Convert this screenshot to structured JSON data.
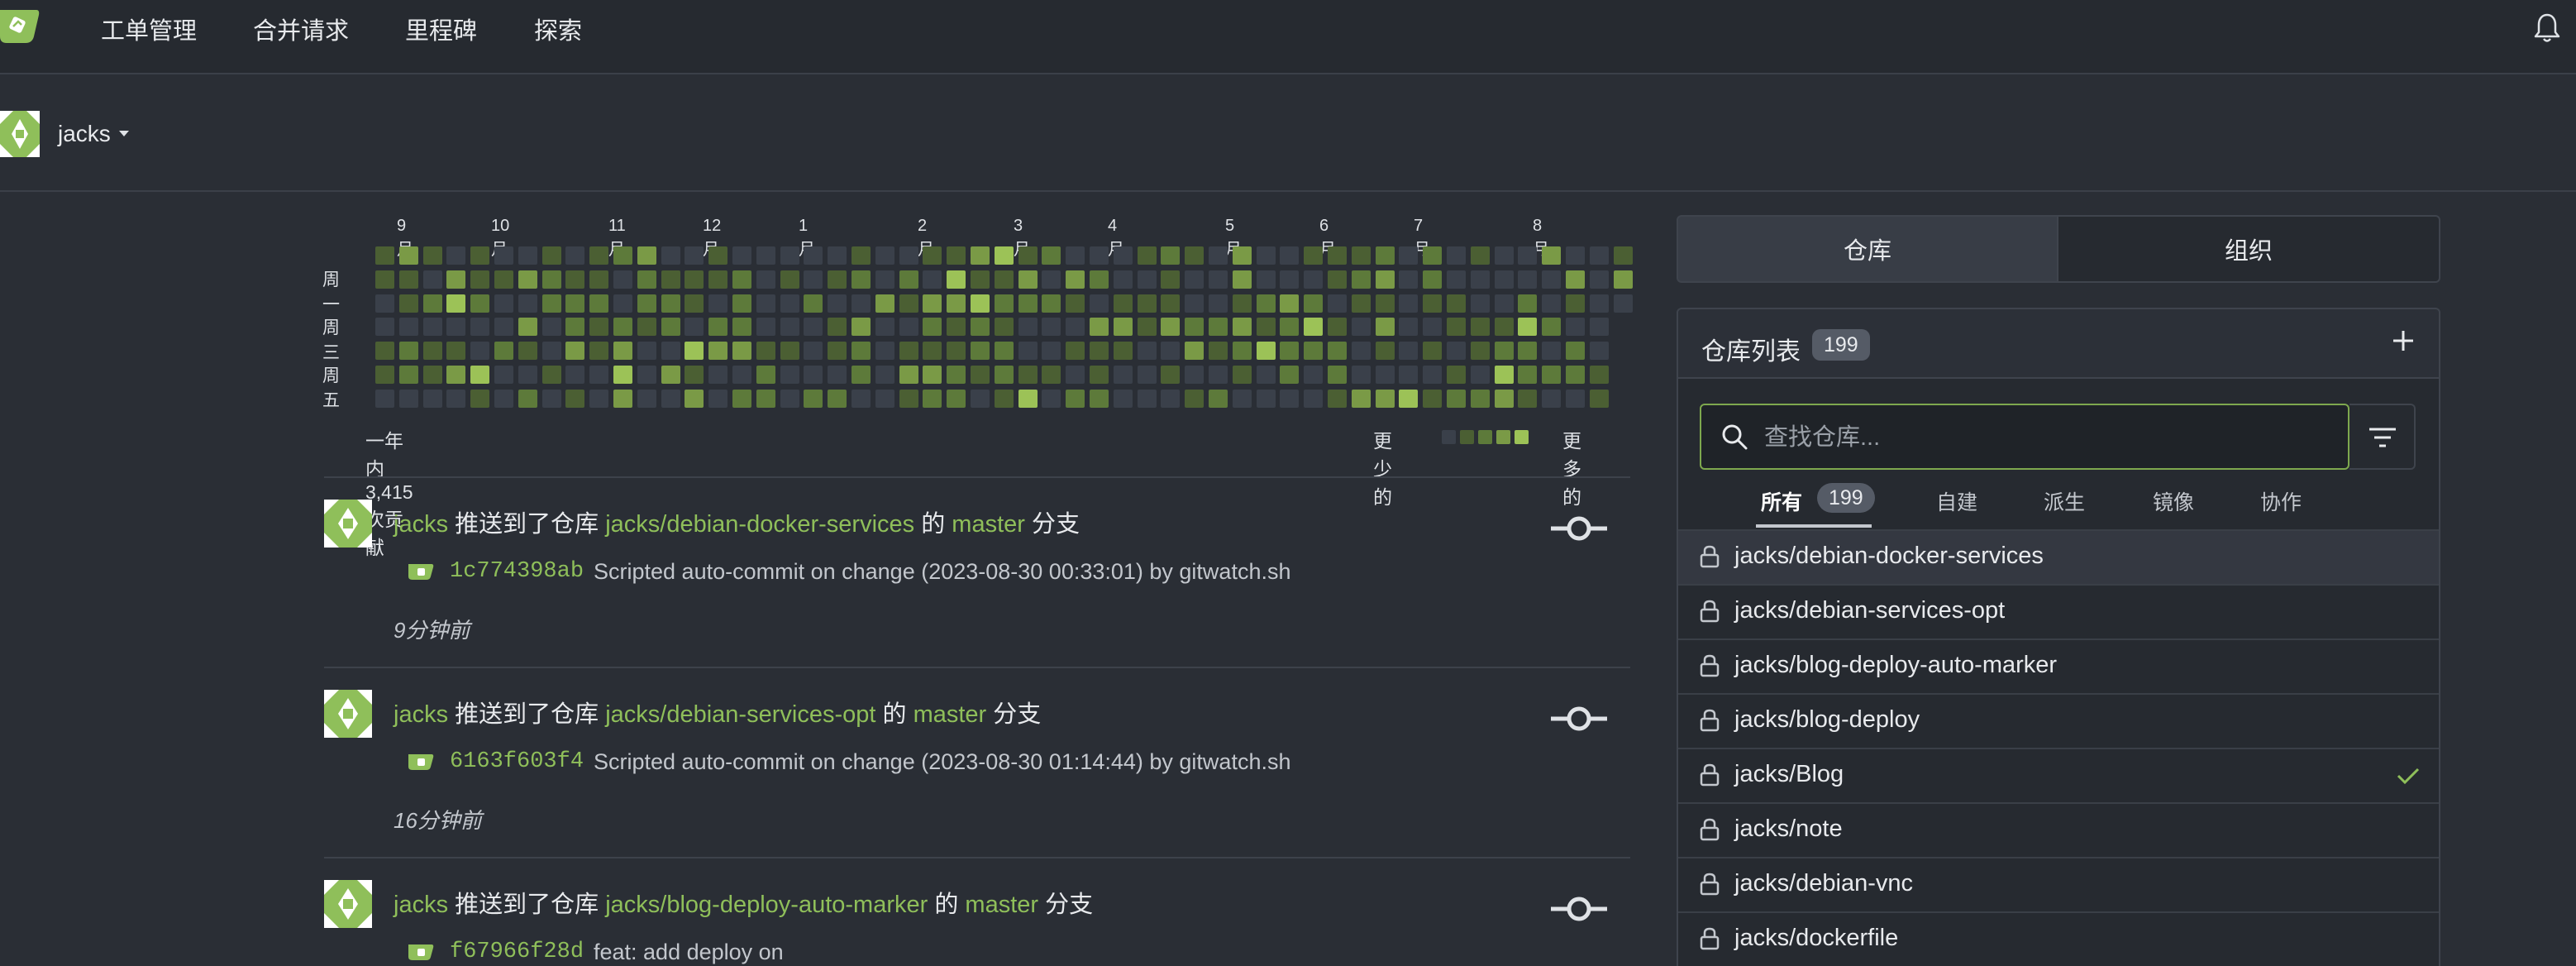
{
  "nav": {
    "items": [
      "工单管理",
      "合并请求",
      "里程碑",
      "探索"
    ]
  },
  "user": {
    "name": "jacks"
  },
  "heatmap": {
    "months": [
      "9月",
      "10月",
      "11月",
      "12月",
      "1月",
      "2月",
      "3月",
      "4月",
      "5月",
      "6月",
      "7月",
      "8月"
    ],
    "day_labels": [
      "周一",
      "周三",
      "周五"
    ],
    "total": "一年内 3,415 次贡献",
    "legend_less": "更少的",
    "legend_more": "更多的",
    "palette": [
      "#3a404a",
      "#4b5f33",
      "#5d7a3a",
      "#7a9a46",
      "#9cc257"
    ]
  },
  "feed": [
    {
      "user": "jacks",
      "action": "推送到了仓库",
      "repo": "jacks/debian-docker-services",
      "of": "的",
      "branch": "master",
      "branch_suffix": "分支",
      "sha": "1c774398ab",
      "message": "Scripted auto-commit on change (2023-08-30 00:33:01) by gitwatch.sh",
      "time": "9分钟前"
    },
    {
      "user": "jacks",
      "action": "推送到了仓库",
      "repo": "jacks/debian-services-opt",
      "of": "的",
      "branch": "master",
      "branch_suffix": "分支",
      "sha": "6163f603f4",
      "message": "Scripted auto-commit on change (2023-08-30 01:14:44) by gitwatch.sh",
      "time": "16分钟前"
    },
    {
      "user": "jacks",
      "action": "推送到了仓库",
      "repo": "jacks/blog-deploy-auto-marker",
      "of": "的",
      "branch": "master",
      "branch_suffix": "分支",
      "sha": "f67966f28d",
      "message": "feat: add deploy on",
      "time": ""
    }
  ],
  "panel": {
    "tab_repos": "仓库",
    "tab_orgs": "组织",
    "title": "仓库列表",
    "count": "199",
    "search_placeholder": "查找仓库...",
    "tabs": [
      "所有",
      "自建",
      "派生",
      "镜像",
      "协作"
    ],
    "all_count": "199",
    "repos": [
      "jacks/debian-docker-services",
      "jacks/debian-services-opt",
      "jacks/blog-deploy-auto-marker",
      "jacks/blog-deploy",
      "jacks/Blog",
      "jacks/note",
      "jacks/debian-vnc",
      "jacks/dockerfile"
    ]
  }
}
